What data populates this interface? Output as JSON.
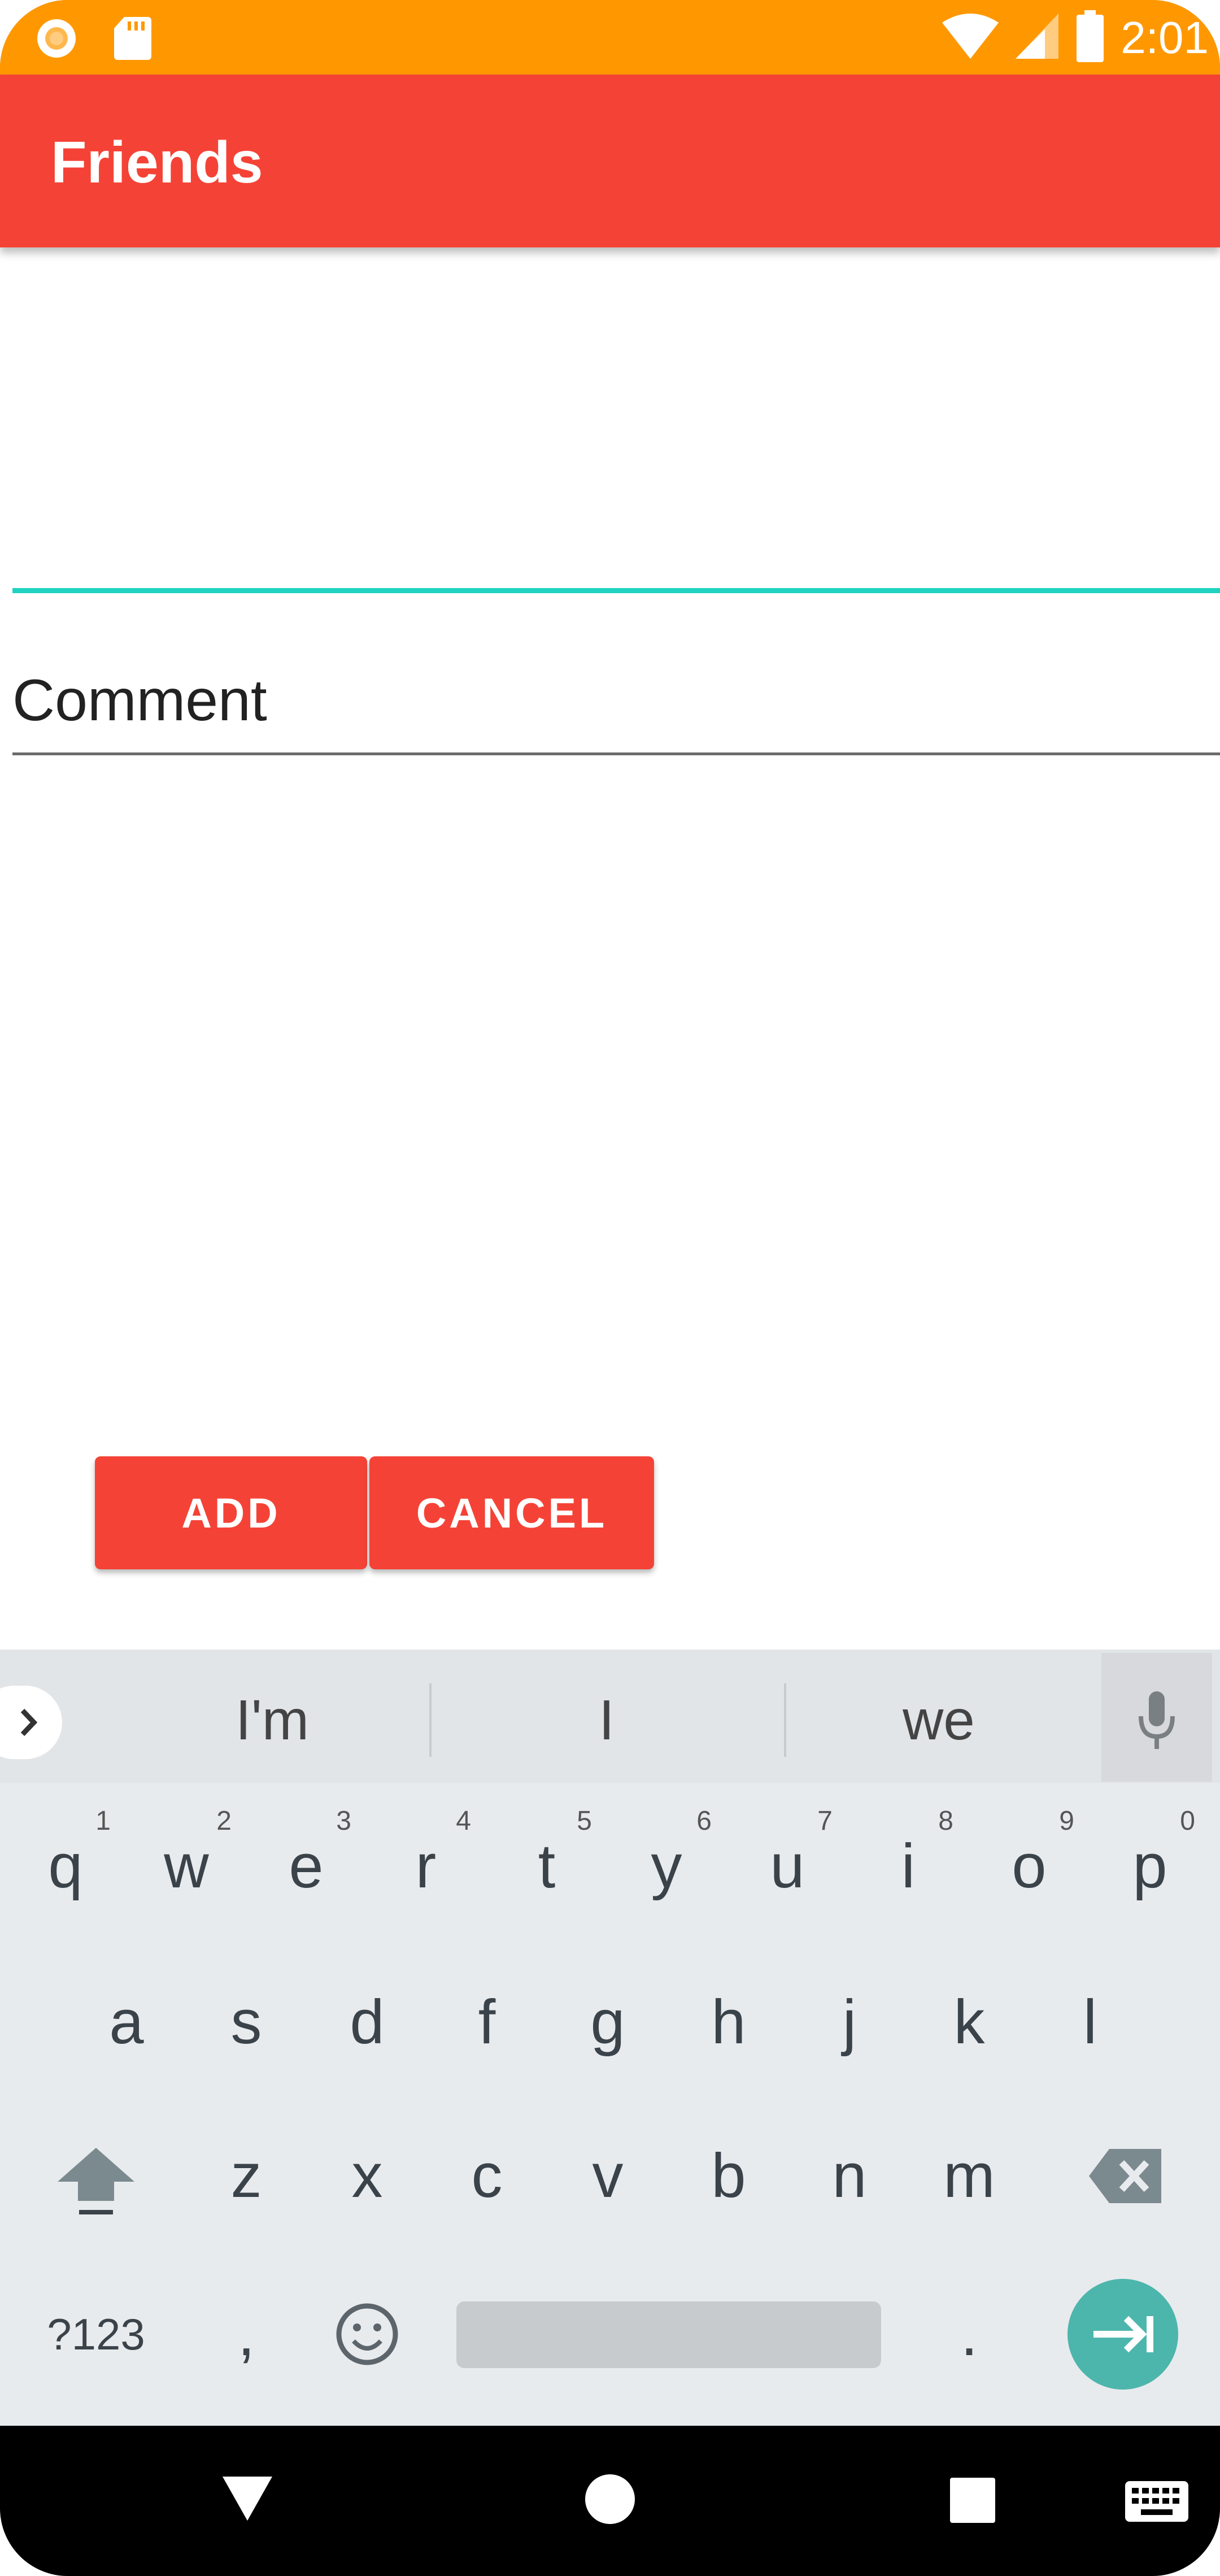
{
  "status_bar": {
    "time": "2:01",
    "color": "#FF9800",
    "left_icons": [
      "chrome-notification-icon",
      "sd-card-icon"
    ],
    "right_icons": [
      "wifi-icon",
      "cell-signal-icon",
      "battery-icon"
    ]
  },
  "app_bar": {
    "title": "Friends",
    "color": "#F44336"
  },
  "form": {
    "field1_value": "",
    "comment_hint": "Comment",
    "accent_color": "#1FD3C0"
  },
  "buttons": {
    "add_label": "ADD",
    "cancel_label": "CANCEL"
  },
  "keyboard": {
    "suggestions": [
      "I'm",
      "I",
      "we"
    ],
    "row1": [
      {
        "k": "q",
        "h": "1"
      },
      {
        "k": "w",
        "h": "2"
      },
      {
        "k": "e",
        "h": "3"
      },
      {
        "k": "r",
        "h": "4"
      },
      {
        "k": "t",
        "h": "5"
      },
      {
        "k": "y",
        "h": "6"
      },
      {
        "k": "u",
        "h": "7"
      },
      {
        "k": "i",
        "h": "8"
      },
      {
        "k": "o",
        "h": "9"
      },
      {
        "k": "p",
        "h": "0"
      }
    ],
    "row2": [
      "a",
      "s",
      "d",
      "f",
      "g",
      "h",
      "j",
      "k",
      "l"
    ],
    "row3": [
      "z",
      "x",
      "c",
      "v",
      "b",
      "n",
      "m"
    ],
    "symbols_label": "?123",
    "comma": ",",
    "period": ".",
    "enter_color": "#4DB6AC"
  },
  "nav_bar": {
    "buttons": [
      "back-icon",
      "home-icon",
      "recents-icon",
      "keyboard-switch-icon"
    ]
  }
}
